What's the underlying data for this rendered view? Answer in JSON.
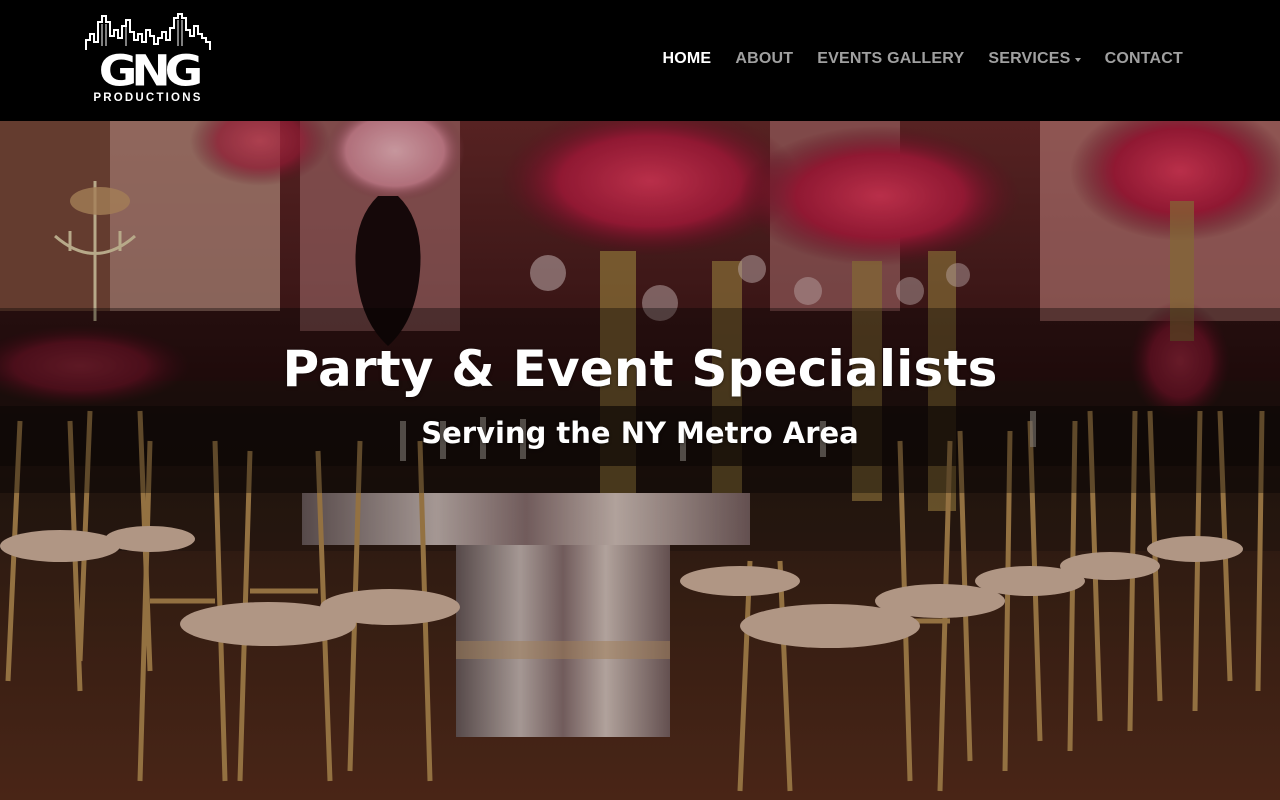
{
  "brand": {
    "logo_text": "GNG",
    "logo_subtext": "PRODUCTIONS"
  },
  "nav": {
    "items": [
      {
        "label": "HOME",
        "active": true
      },
      {
        "label": "ABOUT",
        "active": false
      },
      {
        "label": "EVENTS GALLERY",
        "active": false
      },
      {
        "label": "SERVICES",
        "active": false,
        "dropdown": true
      },
      {
        "label": "CONTACT",
        "active": false
      }
    ]
  },
  "hero": {
    "title": "Party & Event Specialists",
    "subtitle": "Serving the NY Metro Area"
  },
  "colors": {
    "navbar_bg": "#000000",
    "nav_active": "#ffffff",
    "nav_inactive": "#a4a4a4",
    "hero_text": "#ffffff"
  }
}
